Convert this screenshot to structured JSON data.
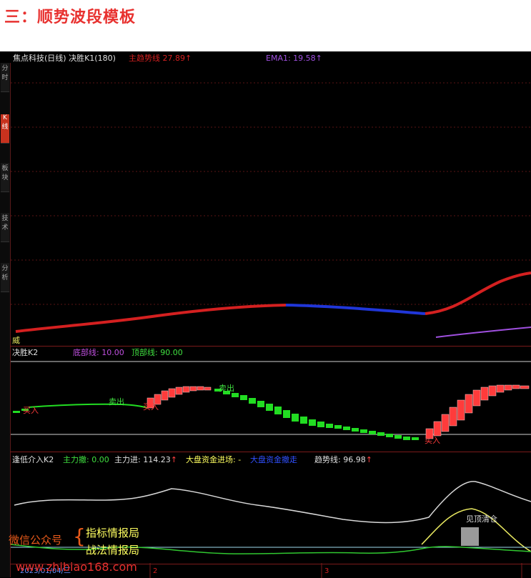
{
  "heading": "三：顺势波段模板",
  "panel1": {
    "stock": "焦点科技(日线)",
    "indicator": "决胜K1(180)",
    "trend_label": "主趋势线",
    "trend_value": "27.89",
    "ema_label": "EMA1:",
    "ema_value": "19.58",
    "arrow": "↑",
    "corner_label": "威"
  },
  "panel2": {
    "title": "决胜K2",
    "bottom_label": "底部线:",
    "bottom_value": "10.00",
    "top_label": "顶部线:",
    "top_value": "90.00",
    "buy_label": "买入",
    "sell_label": "卖出"
  },
  "panel3": {
    "title": "逢低介入K2",
    "main_sell_label": "主力撤:",
    "main_sell_value": "0.00",
    "main_buy_label": "主力进:",
    "main_buy_value": "114.23",
    "market_label": "大盘资金进场:",
    "market_value": "-",
    "market_exit_label": "大盘资金撤走",
    "trend_label": "趋势线:",
    "trend_value": "96.98",
    "clear_label": "见顶清仓"
  },
  "timeline": {
    "date": "2023/01/04/三",
    "month_2": "2",
    "month_3": "3"
  },
  "watermark": {
    "wechat": "微信公众号",
    "brand1": "指标情报局",
    "brand2": "战法情报局",
    "url": "www.zhibiao168.com"
  },
  "sidebar_tabs": [
    "分",
    "时",
    "K",
    "线",
    "板",
    "块",
    "技",
    "术",
    "分",
    "析"
  ],
  "colors": {
    "trend_red": "#d42020",
    "trend_blue": "#2036d8",
    "buy_red": "#ff3b3b",
    "sell_green": "#22dd22",
    "ema_purple": "#a050e0"
  }
}
